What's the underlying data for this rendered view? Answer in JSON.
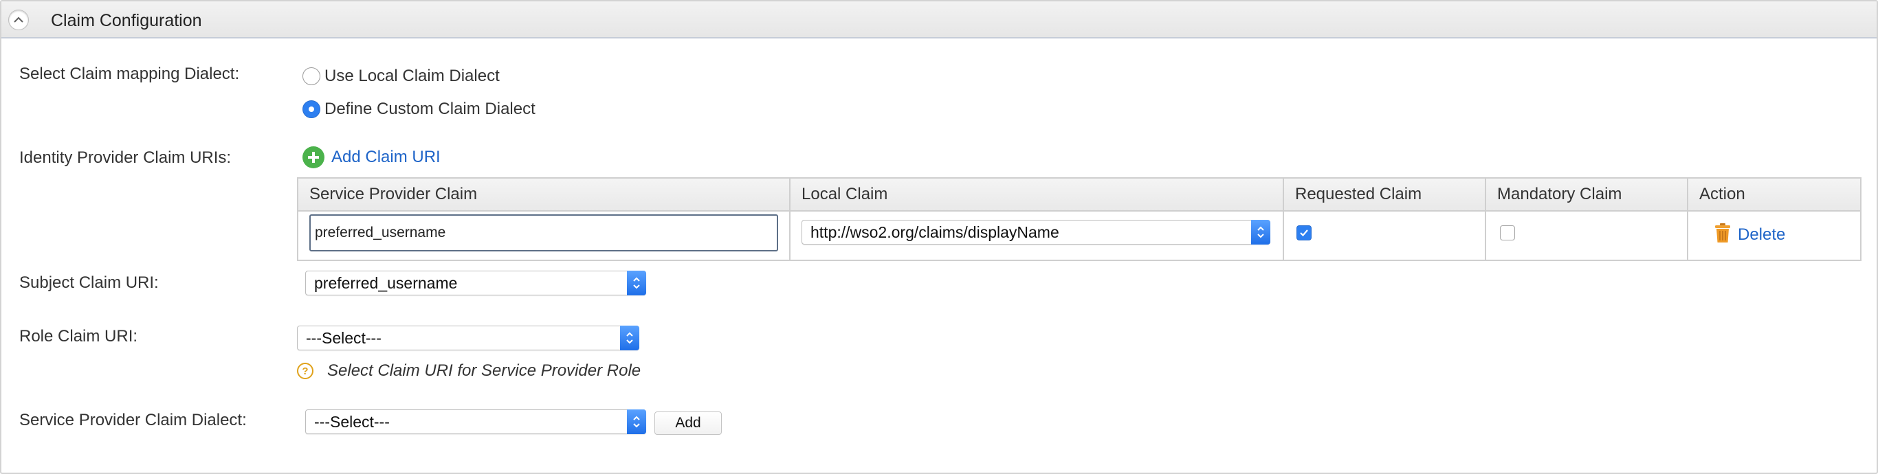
{
  "panel": {
    "title": "Claim Configuration"
  },
  "dialect": {
    "label": "Select Claim mapping Dialect:",
    "options": [
      {
        "label": "Use Local Claim Dialect",
        "checked": false
      },
      {
        "label": "Define Custom Claim Dialect",
        "checked": true
      }
    ]
  },
  "idp_claims": {
    "label": "Identity Provider Claim URIs:",
    "add_label": "Add Claim URI",
    "columns": [
      "Service Provider Claim",
      "Local Claim",
      "Requested Claim",
      "Mandatory Claim",
      "Action"
    ],
    "rows": [
      {
        "sp_claim": "preferred_username",
        "local_claim": "http://wso2.org/claims/displayName",
        "requested": true,
        "mandatory": false,
        "action": "Delete"
      }
    ]
  },
  "subject_claim": {
    "label": "Subject Claim URI:",
    "value": "preferred_username"
  },
  "role_claim": {
    "label": "Role Claim URI:",
    "value": "---Select---",
    "hint": "Select Claim URI for Service Provider Role"
  },
  "sp_dialect": {
    "label": "Service Provider Claim Dialect:",
    "value": "---Select---",
    "add_label": "Add"
  },
  "colors": {
    "accent": "#2d7ff0",
    "link": "#1e64c8",
    "add_icon": "#4bb24b",
    "help_icon": "#e0a21b",
    "delete_icon": "#e8951e"
  }
}
